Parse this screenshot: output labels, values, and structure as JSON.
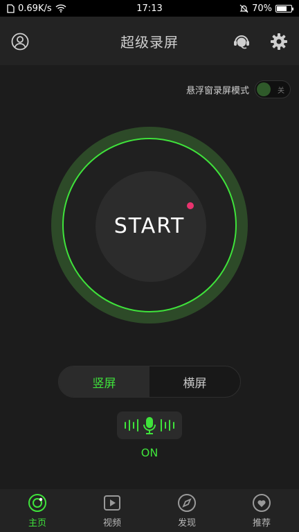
{
  "status_bar": {
    "speed": "0.69K/s",
    "time": "17:13",
    "battery": "70%",
    "battery_level": 0.7
  },
  "header": {
    "title": "超级录屏"
  },
  "float_window": {
    "label": "悬浮窗录屏模式",
    "toggle_text": "关"
  },
  "record": {
    "label": "START"
  },
  "orientation": {
    "portrait": "竖屏",
    "landscape": "横屏"
  },
  "mic": {
    "state": "ON"
  },
  "tabs": [
    {
      "label": "主页",
      "icon": "home-icon"
    },
    {
      "label": "视频",
      "icon": "video-icon"
    },
    {
      "label": "发现",
      "icon": "compass-icon"
    },
    {
      "label": "推荐",
      "icon": "heart-icon"
    }
  ],
  "colors": {
    "accent": "#3fe33b",
    "record_dot": "#e8336e",
    "background": "#1c1c1c"
  }
}
